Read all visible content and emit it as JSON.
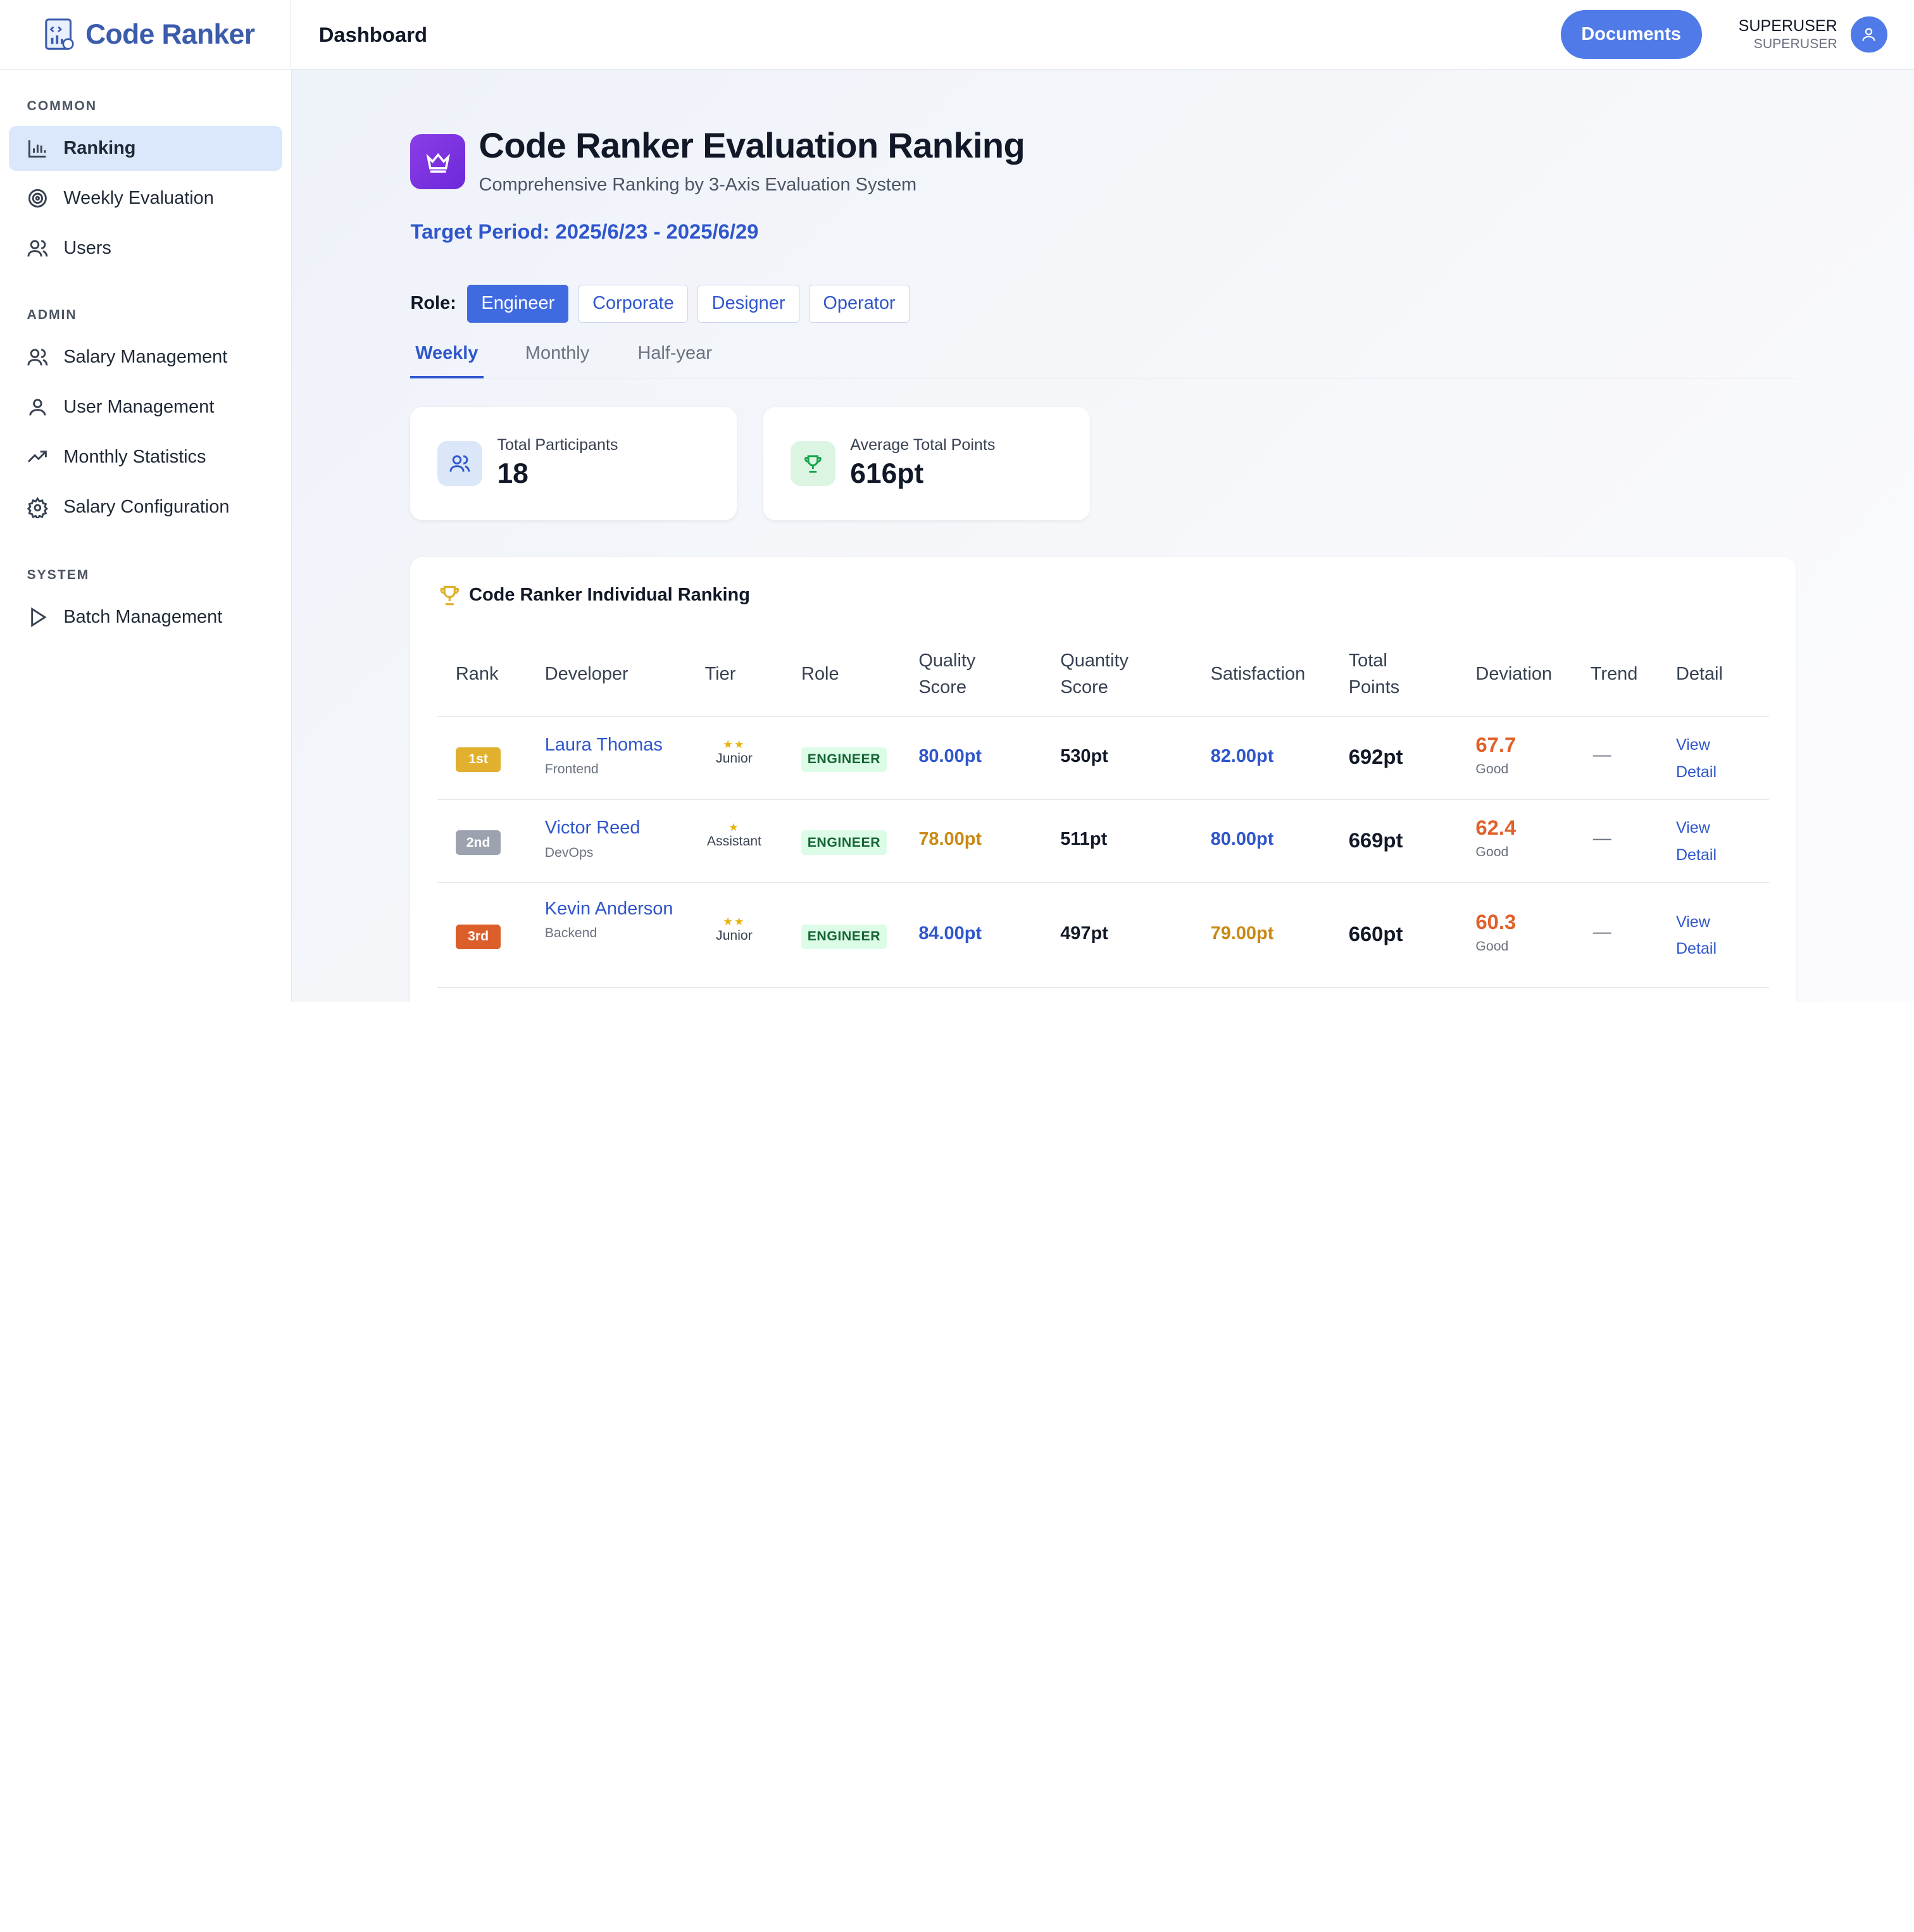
{
  "app": {
    "name": "Code Ranker",
    "page_title": "Dashboard"
  },
  "header": {
    "docs_label": "Documents",
    "user_name": "SUPERUSER",
    "user_role": "SUPERUSER"
  },
  "sidebar": {
    "sections": [
      {
        "title": "COMMON",
        "items": [
          {
            "label": "Ranking",
            "icon": "bar-chart-icon",
            "active": true
          },
          {
            "label": "Weekly Evaluation",
            "icon": "target-icon"
          },
          {
            "label": "Users",
            "icon": "users-icon"
          }
        ]
      },
      {
        "title": "ADMIN",
        "items": [
          {
            "label": "Salary Management",
            "icon": "users-icon"
          },
          {
            "label": "User Management",
            "icon": "user-icon"
          },
          {
            "label": "Monthly Statistics",
            "icon": "trending-up-icon"
          },
          {
            "label": "Salary Configuration",
            "icon": "gear-icon"
          }
        ]
      },
      {
        "title": "SYSTEM",
        "items": [
          {
            "label": "Batch Management",
            "icon": "play-icon"
          }
        ]
      }
    ]
  },
  "main": {
    "title": "Code Ranker Evaluation Ranking",
    "subtitle": "Comprehensive Ranking by 3-Axis Evaluation System",
    "period": "Target Period: 2025/6/23 - 2025/6/29",
    "role_label": "Role:",
    "roles": [
      "Engineer",
      "Corporate",
      "Designer",
      "Operator"
    ],
    "active_role": "Engineer",
    "tabs": [
      "Weekly",
      "Monthly",
      "Half-year"
    ],
    "active_tab": "Weekly",
    "stats": [
      {
        "label": "Total Participants",
        "value": "18",
        "icon": "users-icon"
      },
      {
        "label": "Average Total Points",
        "value": "616pt",
        "icon": "trophy-icon"
      }
    ],
    "ranking": {
      "title": "Code Ranker Individual Ranking",
      "columns": [
        "Rank",
        "Developer",
        "Tier",
        "Role",
        "Quality Score",
        "Quantity Score",
        "Satisfaction",
        "Total Points",
        "Deviation",
        "Trend",
        "Detail"
      ],
      "rows": [
        {
          "rank": "1st",
          "name": "Laura Thomas",
          "team": "Frontend",
          "tier_stars": "★★",
          "tier": "Junior",
          "role": "ENGINEER",
          "quality": "80.00pt",
          "quantity": "530pt",
          "satisfaction": "82.00pt",
          "total": "692pt",
          "deviation": "67.7",
          "deviation_label": "Good",
          "trend": "—",
          "detail": "View Detail"
        },
        {
          "rank": "2nd",
          "name": "Victor Reed",
          "team": "DevOps",
          "tier_stars": "★",
          "tier": "Assistant",
          "role": "ENGINEER",
          "quality": "78.00pt",
          "quantity": "511pt",
          "satisfaction": "80.00pt",
          "total": "669pt",
          "deviation": "62.4",
          "deviation_label": "Good",
          "trend": "—",
          "detail": "View Detail"
        },
        {
          "rank": "3rd",
          "name": "Kevin Anderson",
          "team": "Backend",
          "tier_stars": "★★",
          "tier": "Junior",
          "role": "ENGINEER",
          "quality": "84.00pt",
          "quantity": "497pt",
          "satisfaction": "79.00pt",
          "total": "660pt",
          "deviation": "60.3",
          "deviation_label": "Good",
          "trend": "—",
          "detail": "View Detail"
        }
      ]
    }
  },
  "colors": {
    "accent": "#2f56cc",
    "brand": "#3b5bab",
    "button": "#4f7ae8",
    "gold": "#e0b02e",
    "silver": "#9ca3af",
    "bronze": "#dc5f2b"
  }
}
